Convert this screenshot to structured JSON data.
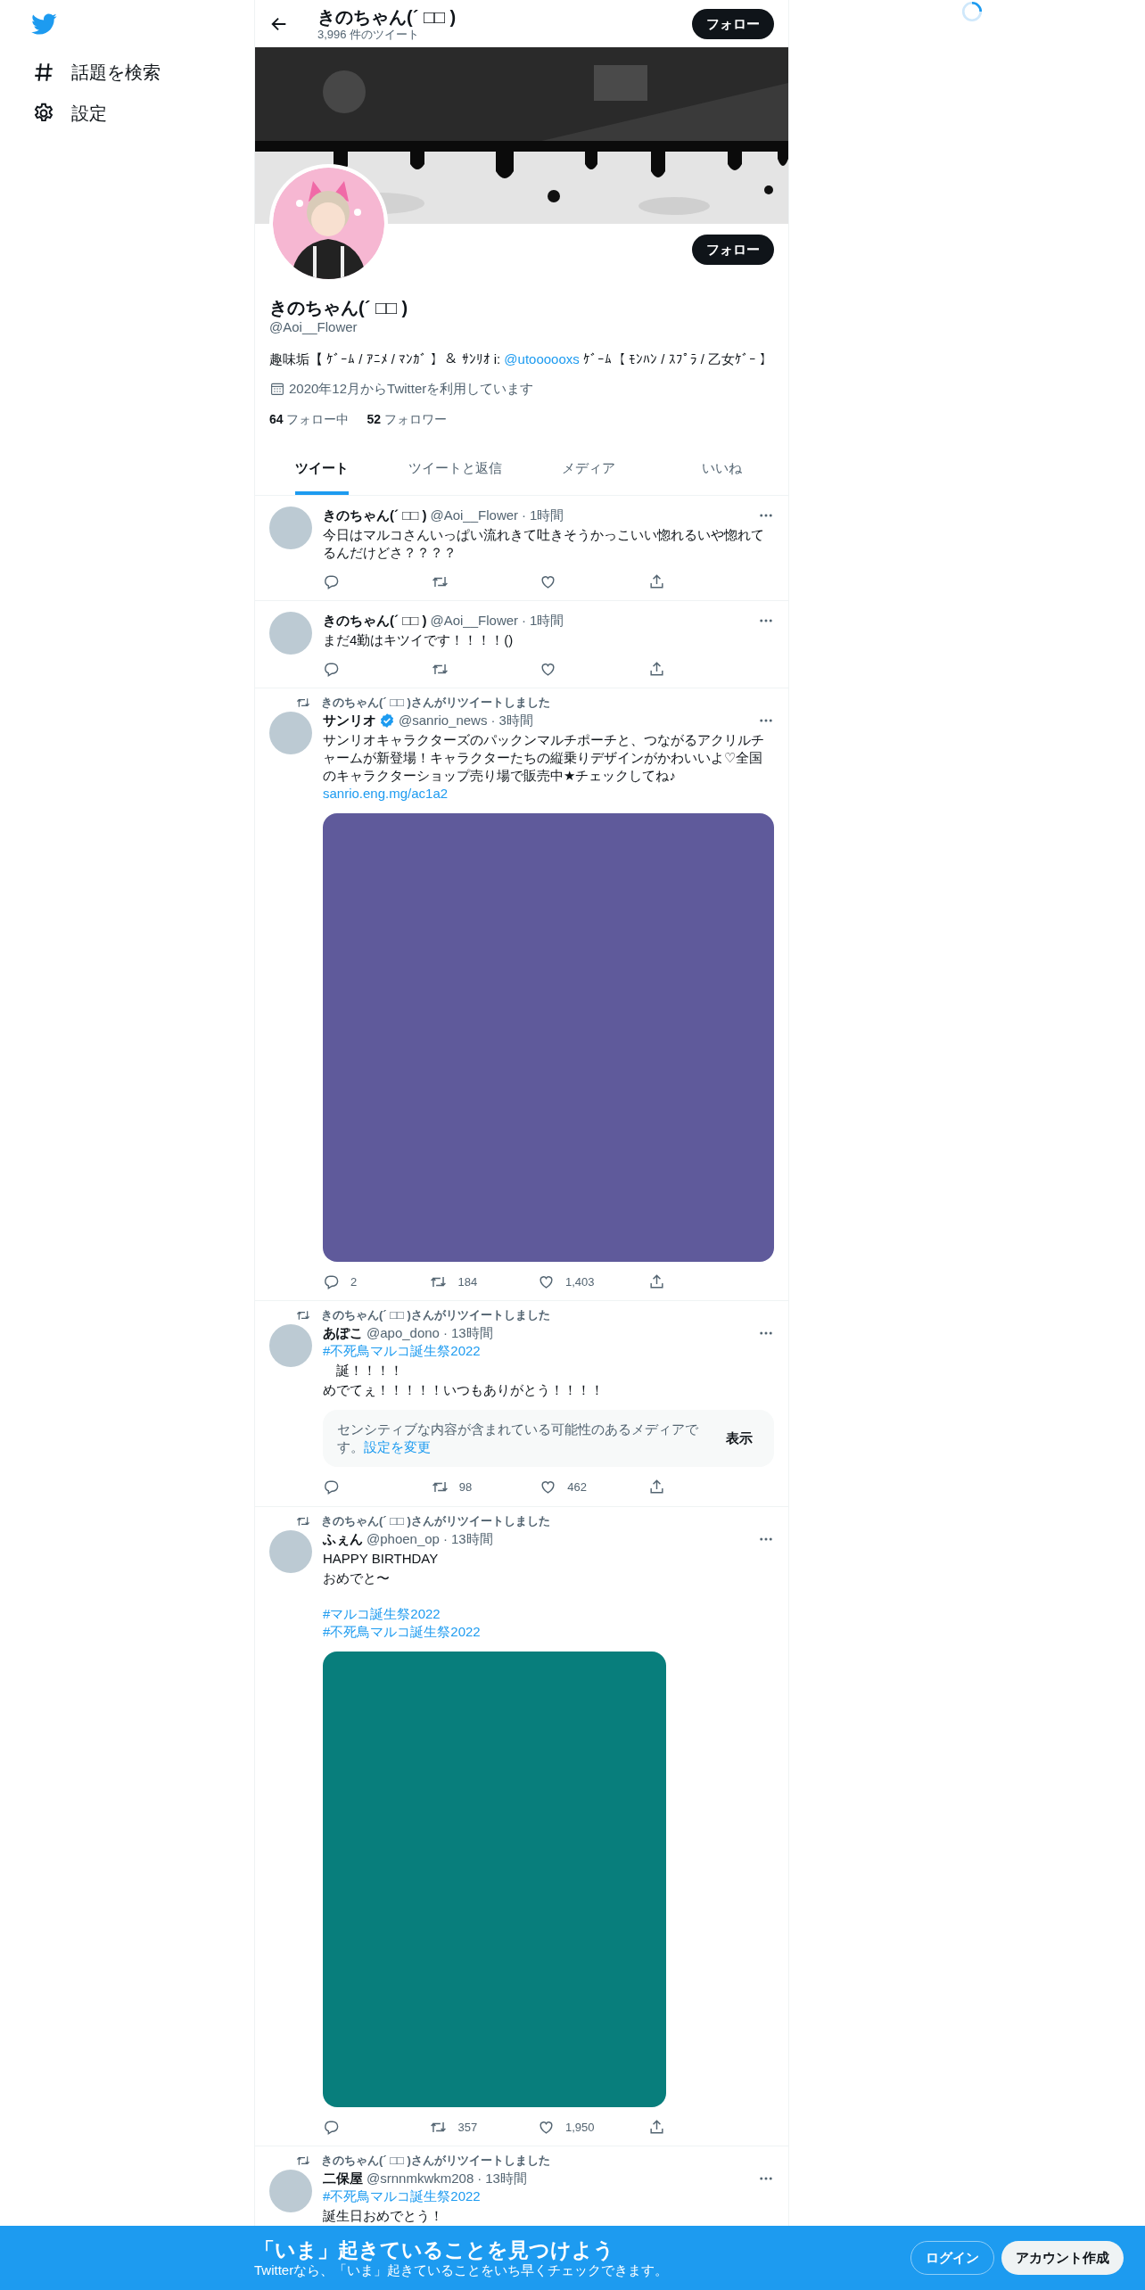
{
  "sidebar": {
    "items": [
      {
        "kind": "explore",
        "label": "話題を検索"
      },
      {
        "kind": "settings",
        "label": "設定"
      }
    ]
  },
  "header": {
    "title": "きのちゃん(´ □□ )",
    "subtitle": "3,996 件のツイート",
    "button": "フォロー"
  },
  "profile": {
    "button": "フォロー",
    "name": "きのちゃん(´ □□ )",
    "handle": "@Aoi__Flower",
    "bio": [
      {
        "kind": "text",
        "text": "趣味垢【 ｹﾞｰﾑ / ｱﾆﾒ / ﾏﾝｶﾞ 】＆ ｻﾝﾘｵ i: "
      },
      {
        "kind": "mention",
        "text": "@utoooooxs"
      },
      {
        "kind": "text",
        "text": " ｹﾞｰﾑ【 ﾓﾝﾊﾝ / ｽﾌﾟﾗ / 乙女ｹﾞｰ 】"
      }
    ],
    "joined": "2020年12月からTwitterを利用しています",
    "following": "**64** フォロー中",
    "followers": "**52** フォロワー"
  },
  "tabs": [
    {
      "label": "ツイート",
      "selected": true
    },
    {
      "label": "ツイートと返信",
      "selected": false
    },
    {
      "label": "メディア",
      "selected": false
    },
    {
      "label": "いいね",
      "selected": false
    }
  ],
  "tweets": [
    {
      "name": "きのちゃん(´ □□ )",
      "verified": false,
      "handle": "@Aoi__Flower",
      "separator": "·",
      "time": "1時間",
      "body": [
        {
          "kind": "text",
          "text": "今日はマルコさんいっぱい流れきて吐きそうかっこいい惚れるいや惚れてるんだけどさ？？？？"
        }
      ],
      "actions": true
    },
    {
      "name": "きのちゃん(´ □□ )",
      "verified": false,
      "handle": "@Aoi__Flower",
      "separator": "·",
      "time": "1時間",
      "body": [
        {
          "kind": "text",
          "text": "まだ4勤はキツイです！！！！()"
        }
      ],
      "actions": true
    },
    {
      "retweeted_by": "きのちゃん(´ □□ )さんがリツイートしました",
      "name": "サンリオ",
      "verified": true,
      "handle": "@sanrio_news",
      "separator": "·",
      "time": "3時間",
      "body": [
        {
          "kind": "text",
          "text": "サンリオキャラクターズのパックンマルチポーチと、つながるアクリルチャームが新登場！キャラクターたちの縦乗りデザインがかわいいよ♡全国のキャラクターショップ売り場で販売中★チェックしてね♪"
        },
        {
          "kind": "link",
          "text": "sanrio.eng.mg/ac1a2"
        }
      ],
      "media": {
        "kind": "wide",
        "color": "#5f5a9b"
      },
      "actions": true,
      "counts": {
        "reply": "2",
        "retweet": "184",
        "like": "1,403"
      }
    },
    {
      "retweeted_by": "きのちゃん(´ □□ )さんがリツイートしました",
      "name": "あぽこ",
      "verified": false,
      "handle": "@apo_dono",
      "separator": "·",
      "time": "13時間",
      "body": [
        {
          "kind": "hashtag",
          "text": "#不死鳥マルコ誕生祭2022"
        },
        {
          "kind": "text",
          "text": "　誕！！！！"
        },
        {
          "kind": "text",
          "text": "めでてぇ！！！！！いつもありがとう！！！！"
        }
      ],
      "sensitive": {
        "text": "センシティブな内容が含まれている可能性のあるメディアです。",
        "link": "設定を変更",
        "button": "表示"
      },
      "actions": true,
      "counts": {
        "retweet": "98",
        "like": "462"
      }
    },
    {
      "retweeted_by": "きのちゃん(´ □□ )さんがリツイートしました",
      "name": "ふぇん",
      "verified": false,
      "handle": "@phoen_op",
      "separator": "·",
      "time": "13時間",
      "body": [
        {
          "kind": "text",
          "text": "HAPPY BIRTHDAY"
        },
        {
          "kind": "text",
          "text": "おめでと〜"
        },
        {
          "kind": "gap"
        },
        {
          "kind": "hashtag",
          "text": "#マルコ誕生祭2022"
        },
        {
          "kind": "hashtag",
          "text": "#不死鳥マルコ誕生祭2022"
        }
      ],
      "media": {
        "kind": "tall",
        "color": "#087e7c"
      },
      "actions": true,
      "counts": {
        "retweet": "357",
        "like": "1,950"
      }
    },
    {
      "retweeted_by": "きのちゃん(´ □□ )さんがリツイートしました",
      "name": "二保屋",
      "verified": false,
      "handle": "@srnnmkwkm208",
      "separator": "·",
      "time": "13時間",
      "body": [
        {
          "kind": "hashtag",
          "text": "#不死鳥マルコ誕生祭2022"
        },
        {
          "kind": "text",
          "text": "誕生日おめでとう！"
        }
      ],
      "actions": false
    }
  ],
  "signup_bar": {
    "title": "「いま」起きていることを見つけよう",
    "subtitle": "Twitterなら、「いま」起きていることをいち早くチェックできます。",
    "login": "ログイン",
    "signup": "アカウント作成"
  }
}
